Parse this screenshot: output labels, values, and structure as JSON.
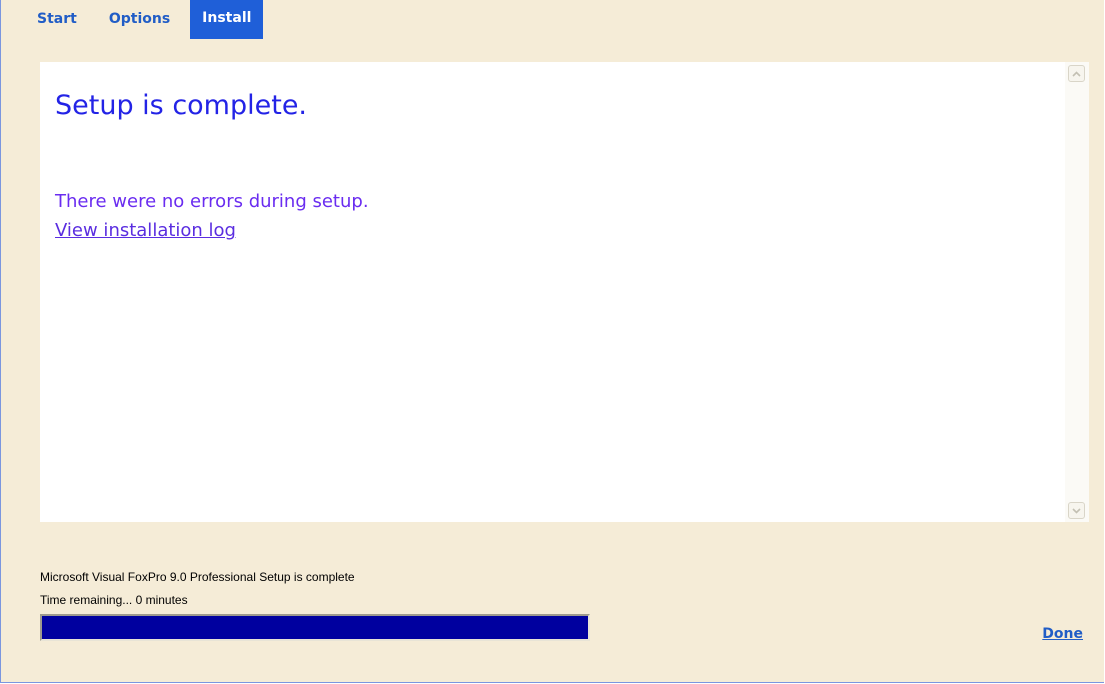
{
  "tabs": [
    {
      "label": "Start"
    },
    {
      "label": "Options"
    },
    {
      "label": "Install"
    }
  ],
  "active_tab": "Install",
  "content": {
    "heading": "Setup is complete.",
    "message": "There were no errors during setup.",
    "log_link": "View installation log"
  },
  "status": {
    "line1": "Microsoft Visual FoxPro 9.0 Professional Setup is complete",
    "line2": "Time remaining... 0 minutes",
    "progress_percent": 100
  },
  "done_label": "Done",
  "colors": {
    "background": "#f5ecd7",
    "tab_active_bg": "#1f5fd8",
    "tab_text": "#215dc6",
    "heading": "#2323e6",
    "message": "#6a2cf0",
    "progress_fill": "#00009f"
  },
  "icons": {
    "scroll_up": "scroll-up-arrow-icon",
    "scroll_down": "scroll-down-arrow-icon"
  }
}
